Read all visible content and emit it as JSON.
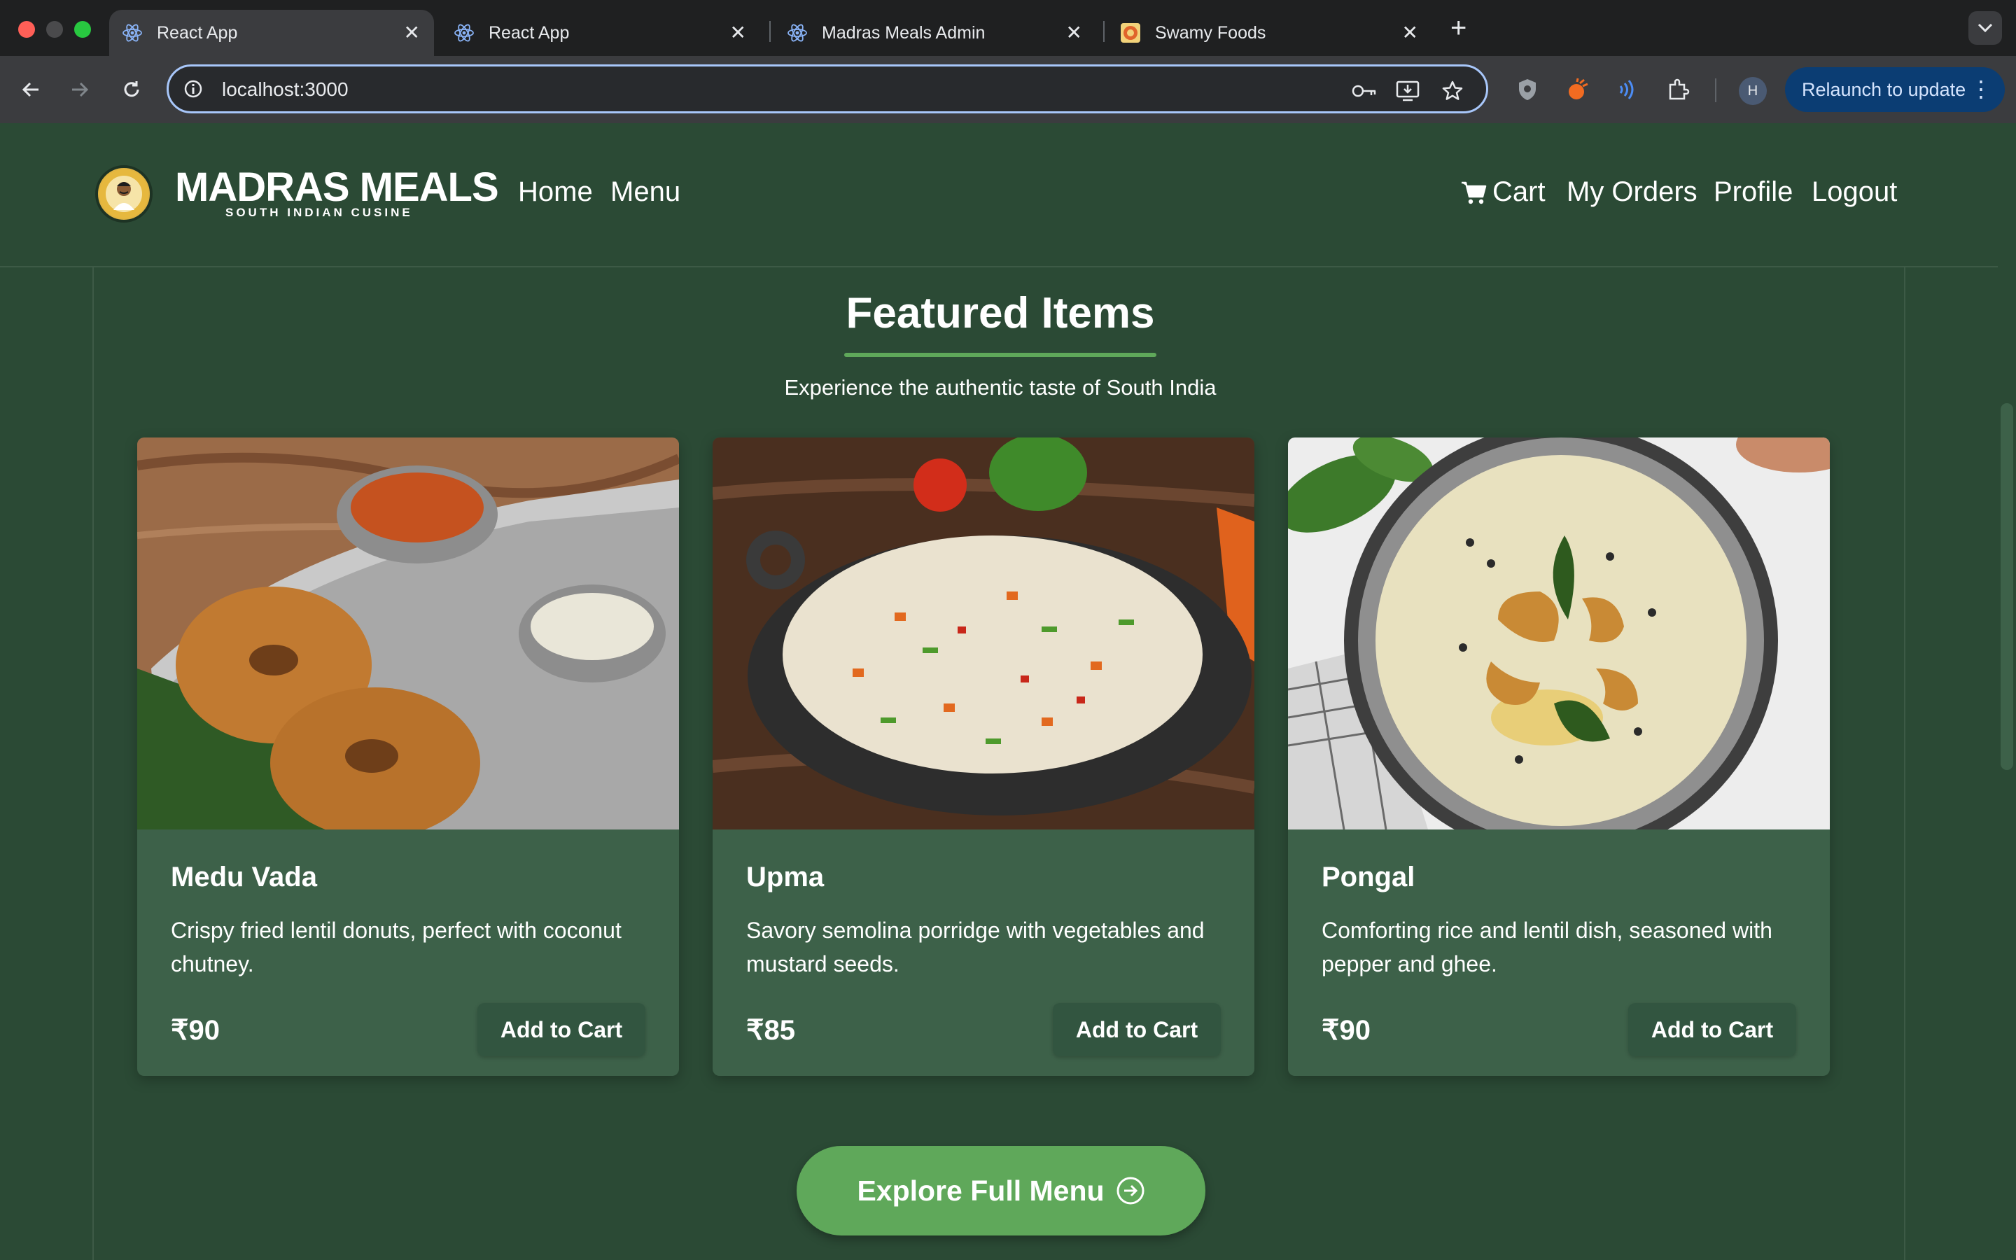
{
  "browser": {
    "tabs": [
      {
        "title": "React App",
        "icon": "react-icon",
        "active": true
      },
      {
        "title": "React App",
        "icon": "react-icon",
        "active": false
      },
      {
        "title": "Madras Meals Admin",
        "icon": "react-icon",
        "active": false
      },
      {
        "title": "Swamy Foods",
        "icon": "swamy-foods-favicon",
        "active": false
      }
    ],
    "url": "localhost:3000",
    "profile_initial": "H",
    "relaunch_label": "Relaunch to update"
  },
  "header": {
    "brand": "MADRAS MEALS",
    "tagline": "SOUTH INDIAN CUSINE",
    "nav_left": [
      "Home",
      "Menu"
    ],
    "cart_label": "Cart",
    "nav_right": [
      "My Orders",
      "Profile",
      "Logout"
    ]
  },
  "featured": {
    "title": "Featured Items",
    "subtitle": "Experience the authentic taste of South India",
    "items": [
      {
        "name": "Medu Vada",
        "description": "Crispy fried lentil donuts, perfect with coconut chutney.",
        "price": "₹90",
        "button": "Add to Cart"
      },
      {
        "name": "Upma",
        "description": "Savory semolina porridge with vegetables and mustard seeds.",
        "price": "₹85",
        "button": "Add to Cart"
      },
      {
        "name": "Pongal",
        "description": "Comforting rice and lentil dish, seasoned with pepper and ghee.",
        "price": "₹90",
        "button": "Add to Cart"
      }
    ],
    "explore_label": "Explore Full Menu"
  },
  "colors": {
    "page_bg": "#2b4a35",
    "card_bg": "#3d6149",
    "accent": "#5fa85a"
  }
}
